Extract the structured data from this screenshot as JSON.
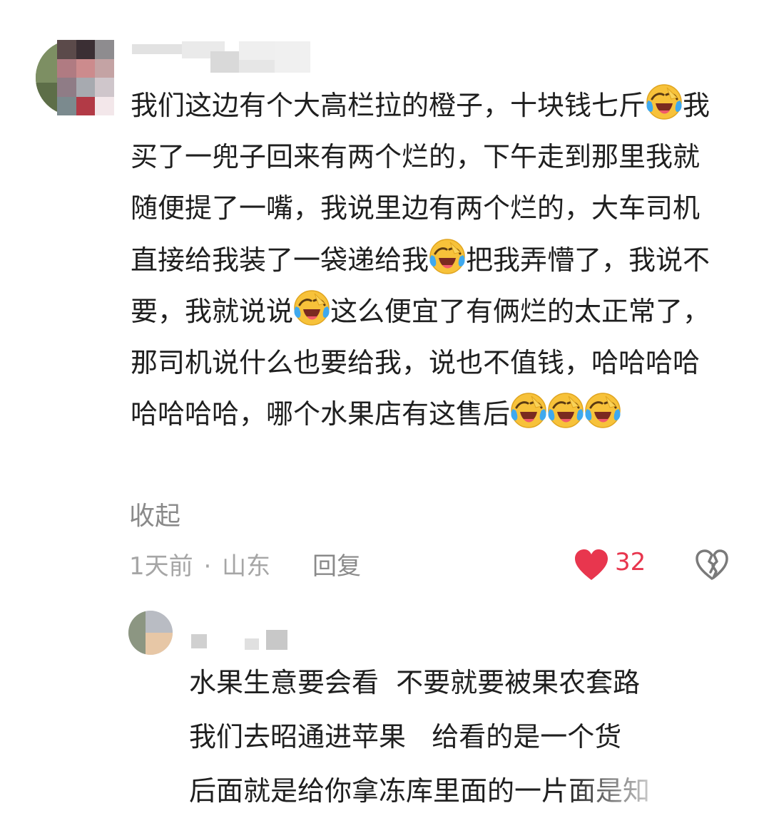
{
  "comment": {
    "segments": [
      {
        "t": "我们这边有个大高栏拉的橙子，十块钱七斤"
      },
      {
        "emoji": "laughing-crying-emoji"
      },
      {
        "t": "我买了一兜子回来有两个烂的，下午走到那里我就随便提了一嘴，我说里边有两个烂的，大车司机直接给我装了一袋递给我"
      },
      {
        "emoji": "laughing-crying-emoji"
      },
      {
        "t": "把我弄懵了，我说不要，我就说说"
      },
      {
        "emoji": "laughing-crying-emoji"
      },
      {
        "t": "这么便宜了有俩烂的太正常了，那司机说什么也要给我，说也不值钱，哈哈哈哈哈哈哈哈，哪个水果店有这售后"
      },
      {
        "emoji": "laughing-crying-emoji"
      },
      {
        "emoji": "laughing-crying-emoji"
      },
      {
        "emoji": "laughing-crying-emoji"
      }
    ],
    "collapse_label": "收起",
    "time": "1天前",
    "separator": "·",
    "location": "山东",
    "reply_label": "回复",
    "like_count": "32",
    "like_color": "#e8364e"
  },
  "reply": {
    "lines": [
      "水果生意要会看  不要就要被果农套路",
      "我们去昭通进苹果   给看的是一个货",
      "后面就是给你拿冻库里面的一片面是知"
    ]
  },
  "icons": {
    "like": "heart-icon",
    "dislike": "broken-heart-icon",
    "emoji": "laughing-crying-emoji"
  }
}
